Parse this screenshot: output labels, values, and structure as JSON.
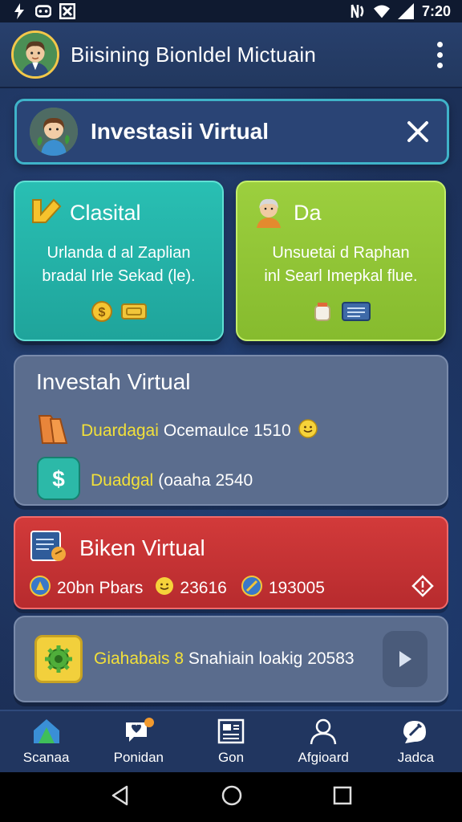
{
  "status_bar": {
    "time": "7:20",
    "left_icons": [
      "flash-icon",
      "game-icon",
      "notification-icon"
    ],
    "right_icons": [
      "nfc-icon",
      "wifi-icon",
      "signal-icon"
    ]
  },
  "app_bar": {
    "title": "Biisining Bionldel Mictuain"
  },
  "banner": {
    "title": "Investasii Virtual"
  },
  "cards": [
    {
      "title": "Clasital",
      "body_line1": "Urlanda d al Zaplian",
      "body_line2": "bradal Irle Sekad (le).",
      "color": "#22b0a6"
    },
    {
      "title": "Da",
      "body_line1": "Unsuetai d Raphan",
      "body_line2": "inl Searl Imepkal flue.",
      "color": "#8fc434"
    }
  ],
  "panel": {
    "title": "Investah Virtual",
    "row1_label": "Duardagai",
    "row1_value": "Ocemaulce 1510",
    "row2_label": "Duadgal",
    "row2_value": "(oaaha 2540"
  },
  "red_bar": {
    "title": "Biken Virtual",
    "stat1": "20bn Pbars",
    "stat2": "23616",
    "stat3": "193005"
  },
  "bottom_card": {
    "label": "Giahabais 8",
    "text": "Snahiain loakig 20583"
  },
  "bottom_nav": [
    {
      "label": "Scanaa",
      "icon": "home-icon"
    },
    {
      "label": "Ponidan",
      "icon": "chat-heart-icon"
    },
    {
      "label": "Gon",
      "icon": "newspaper-icon"
    },
    {
      "label": "Afgioard",
      "icon": "profile-icon"
    },
    {
      "label": "Jadca",
      "icon": "tools-icon"
    }
  ],
  "colors": {
    "background": "#1b2d52",
    "accent_cyan": "#3fb3c9",
    "teal_card": "#22b0a6",
    "green_card": "#8fc434",
    "red_bar": "#c23234",
    "yellow_text": "#f2e03a"
  }
}
